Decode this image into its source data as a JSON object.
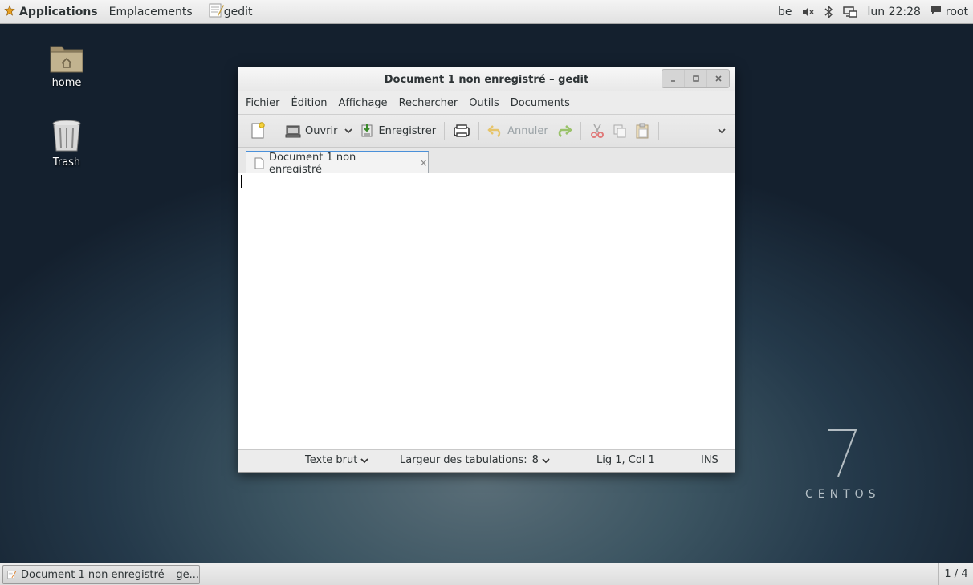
{
  "top_panel": {
    "applications": "Applications",
    "places": "Emplacements",
    "active_app": "gedit",
    "keyboard_layout": "be",
    "clock": "lun 22:28",
    "user": "root"
  },
  "desktop": {
    "icons": [
      {
        "label": "home"
      },
      {
        "label": "Trash"
      }
    ],
    "branding": {
      "version": "7",
      "name": "CENTOS"
    }
  },
  "window": {
    "title": "Document 1 non enregistré – gedit",
    "menu": [
      "Fichier",
      "Édition",
      "Affichage",
      "Rechercher",
      "Outils",
      "Documents"
    ],
    "toolbar": {
      "open_label": "Ouvrir",
      "save_label": "Enregistrer",
      "undo_label": "Annuler"
    },
    "tab": {
      "label": "Document 1 non enregistré",
      "close": "×"
    },
    "editor_content": "",
    "statusbar": {
      "language": "Texte brut",
      "tab_width_label": "Largeur des tabulations:",
      "tab_width_value": "8",
      "position": "Lig 1, Col 1",
      "mode": "INS"
    }
  },
  "taskbar": {
    "task_label": "Document 1 non enregistré – ge...",
    "workspace": "1 / 4"
  },
  "colors": {
    "tab_accent": "#4a90d9",
    "folder": "#b5a684"
  }
}
